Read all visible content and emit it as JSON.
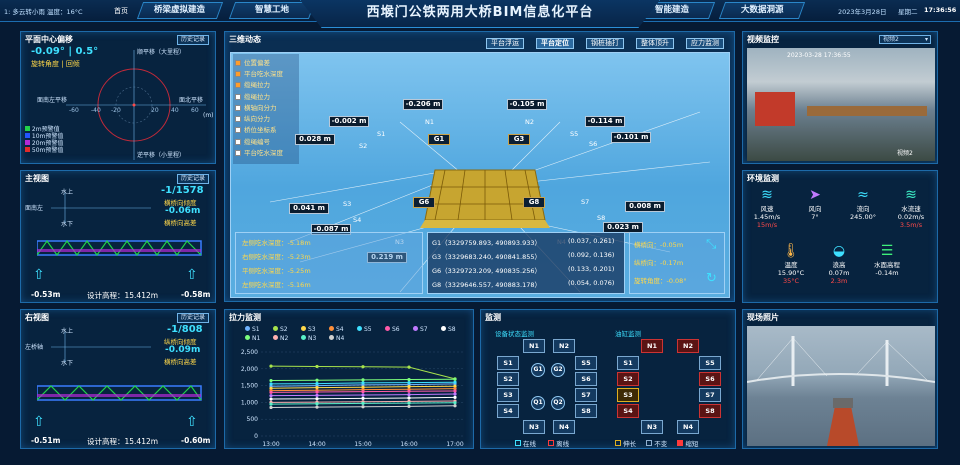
{
  "topbar": {
    "weather": "1: 多云转小雨 温度：16°C",
    "home": "首页",
    "tabs": [
      "桥梁虚拟建造",
      "智慧工地",
      "智能建造",
      "大数据洞源"
    ],
    "title": "西堠门公铁两用大桥BIM信息化平台",
    "date": "2023年3月28日",
    "weekday": "星期二",
    "time": "17:36:56"
  },
  "history_label": "历史记录",
  "plane": {
    "title": "平面中心偏移",
    "deg1": "-0.09°",
    "sep": "|",
    "deg2": "0.5°",
    "label1": "旋转角度",
    "label2": "回倾",
    "axis_top": "顺平移（大里程）",
    "axis_bottom": "逆平移（小里程）",
    "axis_left": "面南左平移",
    "axis_right": "面北平移",
    "unit": "(m)",
    "ticks": [
      "-60",
      "-40",
      "-20",
      "20",
      "40",
      "60"
    ],
    "legend": [
      "2m预警值",
      "10m预警值",
      "20m预警值",
      "50m预警值"
    ],
    "legend_colors": [
      "#22d24a",
      "#2255ff",
      "#b02ad6",
      "#e02a2a"
    ]
  },
  "front": {
    "title": "主视图",
    "ratio": "-1/1578",
    "ratio_label": "横桥向倾度",
    "val": "-0.06m",
    "val_label": "横桥向高差",
    "up": "水上",
    "down": "水下",
    "left_label": "面南左",
    "left": "-0.53m",
    "elev": "设计高程：15.412m",
    "right": "-0.58m"
  },
  "side": {
    "title": "右视图",
    "ratio": "-1/808",
    "ratio_label": "纵桥向倾度",
    "val": "-0.09m",
    "val_label": "横桥向高差",
    "up": "水上",
    "down": "水下",
    "left_label": "左桥轴",
    "left": "-0.51m",
    "elev": "设计高程：15.412m",
    "right": "-0.60m"
  },
  "scene": {
    "title": "三维动态",
    "buttons": [
      "平台浮运",
      "平台定位",
      "钢桩插打",
      "整体顶升",
      "应力监测"
    ],
    "checks": [
      "位置偏差",
      "平台吃水深度",
      "缆绳拉力",
      "缆绳拉力",
      "横轴向分力",
      "纵向分力",
      "桥位坐标系",
      "缆绳编号",
      "平台吃水深度"
    ],
    "checks_on": [
      true,
      true,
      true,
      false,
      false,
      false,
      false,
      false,
      false
    ],
    "tags": [
      "-0.206 m",
      "-0.105 m",
      "-0.002 m",
      "-0.114 m",
      "0.028 m",
      "-0.101 m",
      "0.041 m",
      "0.008 m",
      "-0.087 m",
      "0.219 m",
      "0.023 m"
    ],
    "cable_labels": [
      "N1",
      "N2",
      "S1",
      "S2",
      "S5",
      "S6",
      "S3",
      "S4",
      "S7",
      "S8",
      "N3",
      "N4"
    ],
    "gnss": [
      "G1",
      "G3",
      "G6",
      "G8"
    ],
    "draft": [
      "左侧吃水深度：-5.18m",
      "右侧吃水深度：-5.23m",
      "平侧吃水深度：-5.25m",
      "左侧吃水深度：-5.16m"
    ],
    "coords": [
      "G1（3329759.893, 490893.933）",
      "G3（3329683.240, 490841.855）",
      "G6（3329723.209, 490835.256）",
      "G8（3329646.557, 490883.178）"
    ],
    "offsets": [
      "(0.037, 0.261)",
      "(0.092, 0.136)",
      "(0.133, 0.201)",
      "(0.054, 0.076)"
    ],
    "dev": [
      "横桥向：-0.05m",
      "纵桥向：-0.17m",
      "旋转角度：-0.08°"
    ]
  },
  "camera": {
    "title": "视频监控",
    "select": "视频2",
    "overlay_time": "2023-03-28 17:36:55",
    "overlay_tag": "视频2"
  },
  "env": {
    "title": "环境监测",
    "items": [
      {
        "icon": "wind",
        "label": "风速",
        "value": "1.45m/s",
        "sub": "15m/s"
      },
      {
        "icon": "direction",
        "label": "风向",
        "value": "7°",
        "sub": ""
      },
      {
        "icon": "flow",
        "label": "流向",
        "value": "245.00°",
        "sub": ""
      },
      {
        "icon": "current",
        "label": "水流速",
        "value": "0.02m/s",
        "sub": "3.5m/s"
      },
      {
        "icon": "temp",
        "label": "温度",
        "value": "15.90°C",
        "sub": "35°C"
      },
      {
        "icon": "wave",
        "label": "浪高",
        "value": "0.07m",
        "sub": "2.3m"
      },
      {
        "icon": "tide",
        "label": "水面高程",
        "value": "-0.14m",
        "sub": ""
      }
    ]
  },
  "tension": {
    "title": "拉力监测",
    "series": [
      "S1",
      "S2",
      "S3",
      "S4",
      "S5",
      "S6",
      "S7",
      "S8",
      "N1",
      "N2",
      "N3",
      "N4"
    ],
    "colors": [
      "#6fb3ff",
      "#a7e34c",
      "#ffd84a",
      "#ff8f3a",
      "#3ee0ff",
      "#ff5aa8",
      "#c07aff",
      "#ffffff",
      "#7dff7d",
      "#ffb0b0",
      "#5af0c8",
      "#d0d0d0"
    ],
    "yticks": [
      "2,500",
      "2,000",
      "1,500",
      "1,000",
      "500",
      "0"
    ],
    "xticks": [
      "13:00",
      "14:00",
      "15:00",
      "16:00",
      "17:00"
    ]
  },
  "chart_data": {
    "type": "line",
    "x": [
      "13:00",
      "14:00",
      "15:00",
      "16:00",
      "17:00"
    ],
    "ylim": [
      0,
      2500
    ],
    "series": [
      {
        "name": "S1",
        "values": [
          1480,
          1500,
          1520,
          1530,
          1550
        ]
      },
      {
        "name": "S2",
        "values": [
          2080,
          2070,
          2060,
          2050,
          1700
        ]
      },
      {
        "name": "S3",
        "values": [
          1420,
          1440,
          1450,
          1470,
          1480
        ]
      },
      {
        "name": "S4",
        "values": [
          1350,
          1360,
          1380,
          1390,
          1410
        ]
      },
      {
        "name": "S5",
        "values": [
          1550,
          1560,
          1580,
          1590,
          1600
        ]
      },
      {
        "name": "S6",
        "values": [
          1300,
          1310,
          1320,
          1330,
          1340
        ]
      },
      {
        "name": "S7",
        "values": [
          1200,
          1210,
          1220,
          1230,
          1250
        ]
      },
      {
        "name": "S8",
        "values": [
          1100,
          1110,
          1120,
          1130,
          1150
        ]
      },
      {
        "name": "N1",
        "values": [
          1650,
          1660,
          1670,
          1680,
          1690
        ]
      },
      {
        "name": "N2",
        "values": [
          1000,
          1010,
          1020,
          1030,
          1040
        ]
      },
      {
        "name": "N3",
        "values": [
          950,
          960,
          970,
          980,
          990
        ]
      },
      {
        "name": "N4",
        "values": [
          850,
          860,
          870,
          880,
          900
        ]
      }
    ]
  },
  "monitor": {
    "title": "监测",
    "group1": "设备状态监测",
    "group2": "油缸监测",
    "n": [
      "N1",
      "N2",
      "N3",
      "N4"
    ],
    "s_left": [
      "S1",
      "S2",
      "S3",
      "S4"
    ],
    "s_mid": [
      "S5",
      "S6",
      "S7",
      "S8"
    ],
    "g": [
      "G1",
      "G2",
      "Q1",
      "Q2"
    ],
    "legend": [
      "在线",
      "离线",
      "伸长",
      "不变",
      "缩短"
    ],
    "legend_colors": [
      "#3ee0ff",
      "#ff3a3a",
      "#e0b020",
      "#8fb0d0",
      "#ff3a3a"
    ]
  },
  "photo": {
    "title": "现场照片"
  }
}
